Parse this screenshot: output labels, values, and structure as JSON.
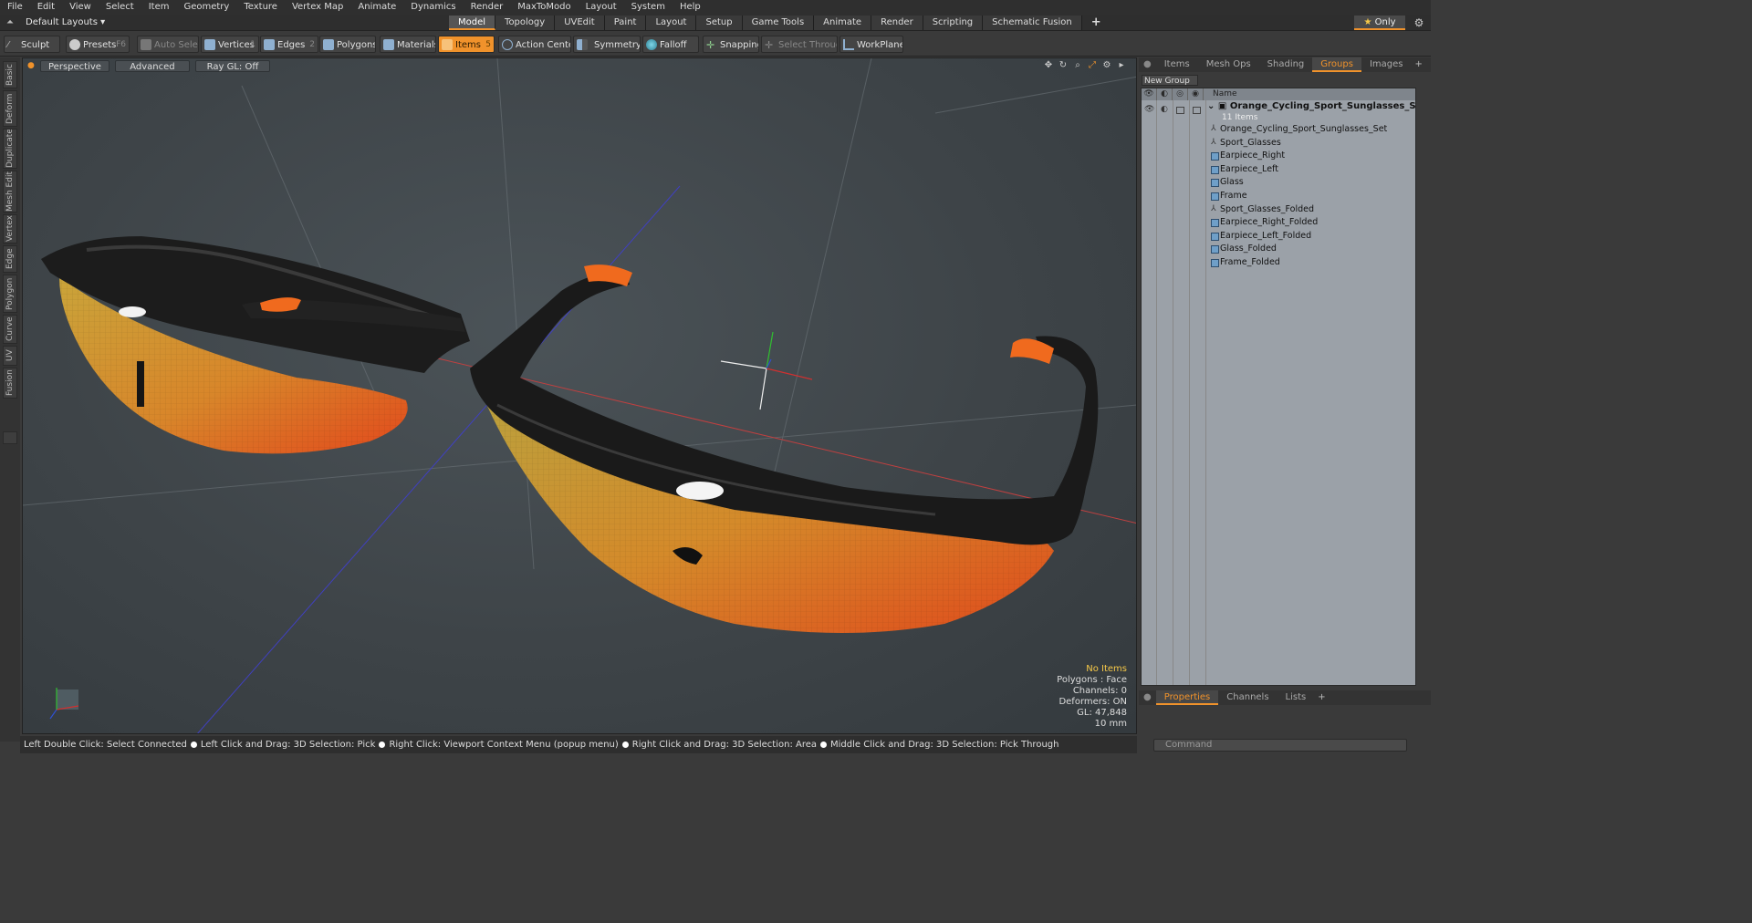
{
  "menu": [
    "File",
    "Edit",
    "View",
    "Select",
    "Item",
    "Geometry",
    "Texture",
    "Vertex Map",
    "Animate",
    "Dynamics",
    "Render",
    "MaxToModo",
    "Layout",
    "System",
    "Help"
  ],
  "layout": {
    "dropdown": "Default Layouts ▾"
  },
  "mode_tabs": [
    {
      "label": "Model",
      "active": true
    },
    {
      "label": "Topology"
    },
    {
      "label": "UVEdit"
    },
    {
      "label": "Paint"
    },
    {
      "label": "Layout"
    },
    {
      "label": "Setup"
    },
    {
      "label": "Game Tools"
    },
    {
      "label": "Animate"
    },
    {
      "label": "Render"
    },
    {
      "label": "Scripting"
    },
    {
      "label": "Schematic Fusion"
    }
  ],
  "only_label": "Only",
  "toolbar": {
    "sculpt": "Sculpt",
    "presets": "Presets",
    "presets_key": "F6",
    "auto_select": "Auto Select",
    "vertices": "Vertices",
    "vertices_num": "1",
    "edges": "Edges",
    "edges_num": "2",
    "polygons": "Polygons",
    "materials": "Materials",
    "items": "Items",
    "items_num": "5",
    "action_center": "Action Center",
    "symmetry": "Symmetry",
    "falloff": "Falloff",
    "snapping": "Snapping",
    "select_through": "Select Through",
    "workplane": "WorkPlane"
  },
  "left_tabs": [
    "Basic",
    "Deform",
    "Duplicate",
    "Mesh Edit",
    "Vertex",
    "Edge",
    "Polygon",
    "Curve",
    "UV",
    "Fusion"
  ],
  "viewport": {
    "perspective": "Perspective",
    "advanced": "Advanced",
    "raygl": "Ray GL: Off",
    "info": {
      "no_items": "No Items",
      "polygons": "Polygons : Face",
      "channels": "Channels: 0",
      "deformers": "Deformers: ON",
      "gl": "GL: 47,848",
      "unit": "10 mm"
    }
  },
  "status": [
    "Left Double Click: Select Connected",
    "Left Click and Drag: 3D Selection: Pick",
    "Right Click: Viewport Context Menu (popup menu)",
    "Right Click and Drag: 3D Selection: Area",
    "Middle Click and Drag: 3D Selection: Pick Through"
  ],
  "right_panel": {
    "tabs": [
      {
        "label": "Items"
      },
      {
        "label": "Mesh Ops"
      },
      {
        "label": "Shading"
      },
      {
        "label": "Groups",
        "active": true
      },
      {
        "label": "Images"
      }
    ],
    "new_group": "New Group",
    "col_name": "Name",
    "root": "Orange_Cycling_Sport_Sunglasses_Set",
    "root_count": "11 Items",
    "items": [
      {
        "label": "Orange_Cycling_Sport_Sunglasses_Set",
        "kind": "locator"
      },
      {
        "label": "Sport_Glasses",
        "kind": "locator"
      },
      {
        "label": "Earpiece_Right",
        "kind": "mesh"
      },
      {
        "label": "Earpiece_Left",
        "kind": "mesh"
      },
      {
        "label": "Glass",
        "kind": "mesh"
      },
      {
        "label": "Frame",
        "kind": "mesh"
      },
      {
        "label": "Sport_Glasses_Folded",
        "kind": "locator"
      },
      {
        "label": "Earpiece_Right_Folded",
        "kind": "mesh"
      },
      {
        "label": "Earpiece_Left_Folded",
        "kind": "mesh"
      },
      {
        "label": "Glass_Folded",
        "kind": "mesh"
      },
      {
        "label": "Frame_Folded",
        "kind": "mesh"
      }
    ],
    "bottom_tabs": [
      {
        "label": "Properties",
        "active": true
      },
      {
        "label": "Channels"
      },
      {
        "label": "Lists"
      }
    ],
    "command_placeholder": "Command"
  },
  "colors": {
    "accent": "#f0922b",
    "lens_top": "#c8a23a",
    "lens_bottom": "#e2561e",
    "frame": "#1c1c1c",
    "tip": "#f06a1e"
  }
}
